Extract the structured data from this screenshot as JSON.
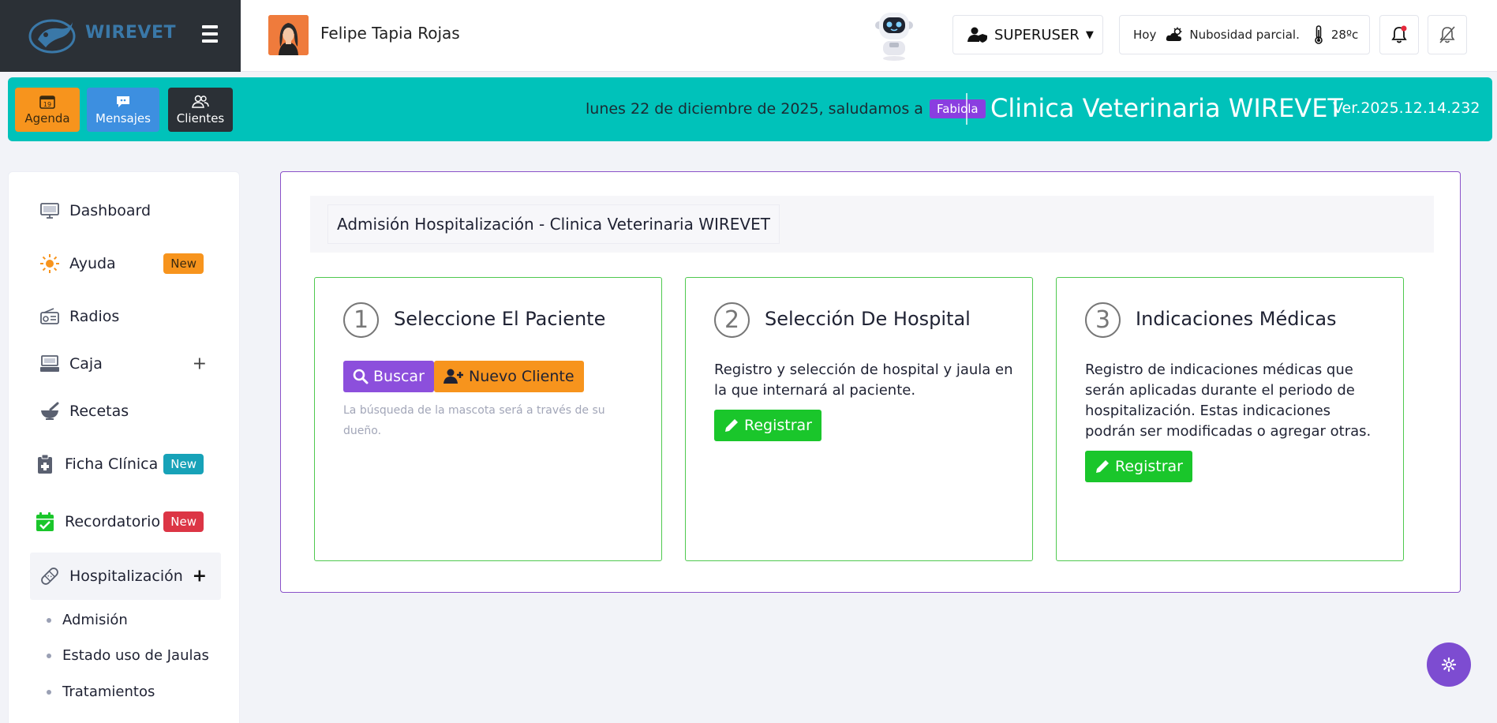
{
  "brand": {
    "name": "WIREVET"
  },
  "header": {
    "user_name": "Felipe Tapia Rojas",
    "role_label": "SUPERUSER",
    "weather": {
      "day": "Hoy",
      "condition": "Nubosidad parcial.",
      "temperature": "28ºc"
    }
  },
  "quickbar": {
    "agenda_label": "Agenda",
    "agenda_day": "19",
    "messages_label": "Mensajes",
    "clients_label": "Clientes",
    "greeting": "lunes 22 de diciembre de 2025, saludamos a",
    "greeted_name": "Fabiola",
    "clinic_title": "Clinica Veterinaria WIREVET",
    "version": "Ver.2025.12.14.232"
  },
  "sidebar": {
    "items": [
      {
        "label": "Dashboard"
      },
      {
        "label": "Ayuda",
        "badge": "New"
      },
      {
        "label": "Radios"
      },
      {
        "label": "Caja",
        "expand": "+"
      },
      {
        "label": "Recetas"
      },
      {
        "label": "Ficha Clínica",
        "badge": "New"
      },
      {
        "label": "Recordatorio",
        "badge": "New"
      },
      {
        "label": "Hospitalización",
        "expand": "+"
      }
    ],
    "subitems": [
      {
        "label": "Admisión"
      },
      {
        "label": "Estado uso de Jaulas"
      },
      {
        "label": "Tratamientos"
      }
    ]
  },
  "colors": {
    "teal": "#00c2ba",
    "purple": "#8c4fdc",
    "orange": "#f7941d",
    "green": "#1ac62b",
    "badge_orange": "#f7941d",
    "badge_teal": "#17a2b8",
    "badge_red": "#dc3545"
  },
  "main": {
    "header_title": "Admisión Hospitalización - Clinica Veterinaria WIREVET",
    "cards": [
      {
        "number": "1",
        "title": "Seleccione El Paciente",
        "search_label": "Buscar",
        "new_client_label": "Nuevo Cliente",
        "hint": "La búsqueda de la mascota será a través de su dueño."
      },
      {
        "number": "2",
        "title": "Selección De Hospital",
        "description": "Registro y selección de hospital y jaula en la que internará al paciente.",
        "button_label": "Registrar"
      },
      {
        "number": "3",
        "title": "Indicaciones Médicas",
        "description": "Registro de indicaciones médicas que serán aplicadas durante el periodo de hospitalización. Estas indicaciones podrán ser modificadas o agregar otras.",
        "button_label": "Registrar"
      }
    ]
  }
}
